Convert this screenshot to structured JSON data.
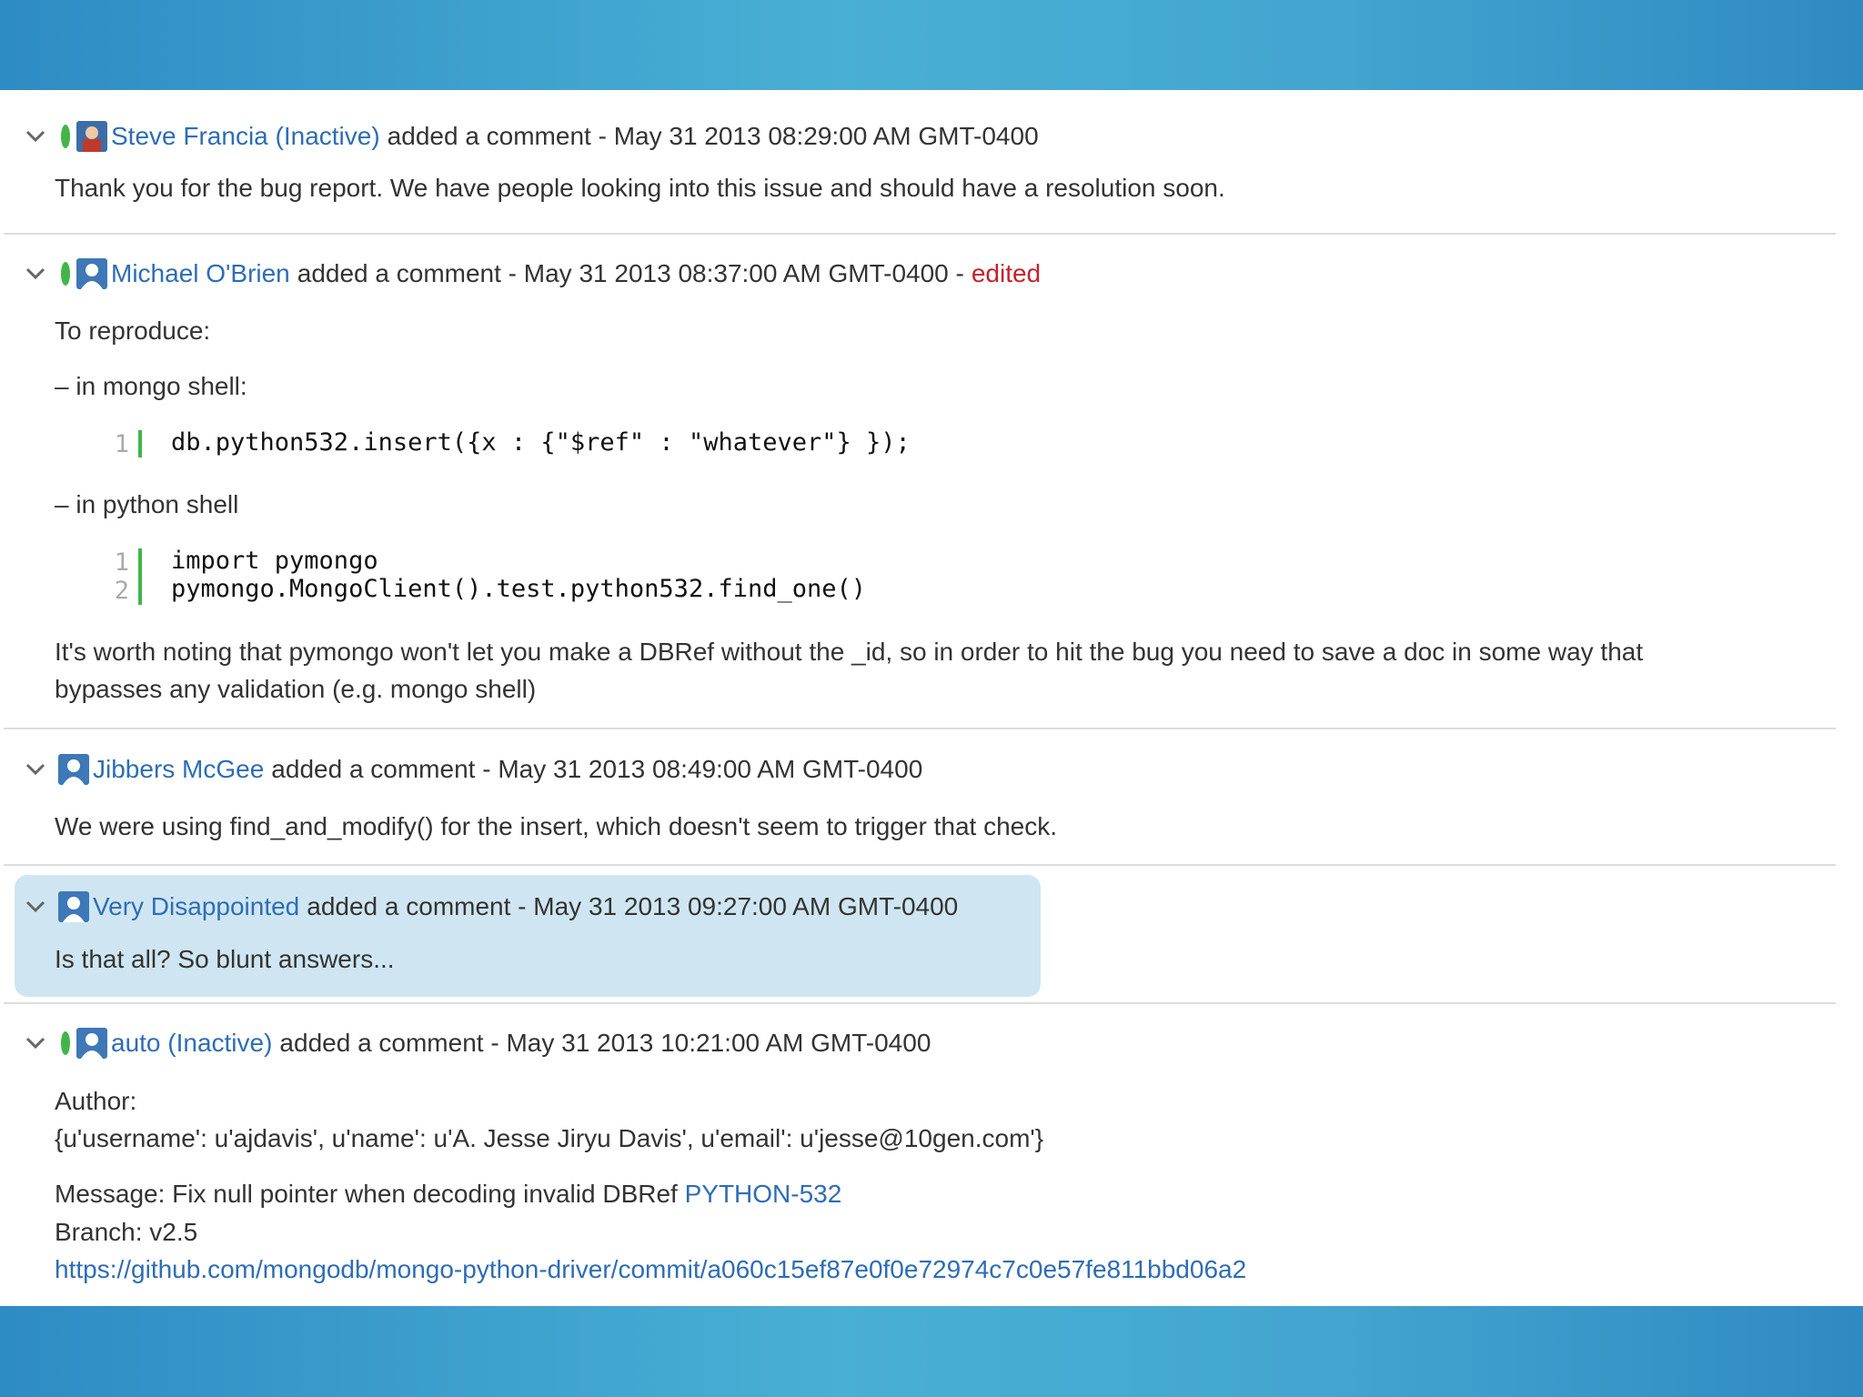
{
  "colors": {
    "accent": "#2e6db4",
    "leaf": "#42b549",
    "edited": "#c3222b",
    "highlight": "#cfe6f2"
  },
  "comments": [
    {
      "author": "Steve Francia (Inactive)",
      "meta": "added a comment - May 31 2013 08:29:00 AM GMT-0400",
      "body": "Thank you for the bug report. We have people looking into this issue and should have a resolution soon."
    },
    {
      "author": "Michael O'Brien",
      "meta": "added a comment - May 31 2013 08:37:00 AM GMT-0400 -",
      "edited": "edited",
      "p1": "To reproduce:",
      "p2": "– in mongo shell:",
      "code1": [
        {
          "n": "1",
          "t": "db.python532.insert({x : {\"$ref\" : \"whatever\"} });"
        }
      ],
      "p3": "– in python shell",
      "code2": [
        {
          "n": "1",
          "t": "import pymongo"
        },
        {
          "n": "2",
          "t": "pymongo.MongoClient().test.python532.find_one()"
        }
      ],
      "p4a": "It's worth noting that pymongo won't let you make a DBRef without the _id, so in order to hit the bug you need to save a doc in some way that",
      "p4b": "bypasses any validation (e.g. mongo shell)"
    },
    {
      "author": "Jibbers McGee",
      "meta": "added a comment - May 31 2013 08:49:00 AM GMT-0400",
      "body": "We were using find_and_modify() for the insert, which doesn't seem to trigger that check."
    },
    {
      "author": "Very Disappointed",
      "meta": "added a comment - May 31 2013 09:27:00 AM GMT-0400",
      "body": "Is that all? So blunt answers..."
    },
    {
      "author": "auto (Inactive)",
      "meta": "added a comment - May 31 2013 10:21:00 AM GMT-0400",
      "l1": "Author:",
      "l2": "{u'username': u'ajdavis', u'name': u'A. Jesse Jiryu Davis', u'email': u'jesse@10gen.com'}",
      "l3": "Message: Fix null pointer when decoding invalid DBRef",
      "l3link": "PYTHON-532",
      "l4": "Branch: v2.5",
      "l5": "https://github.com/mongodb/mongo-python-driver/commit/a060c15ef87e0f0e72974c7c0e57fe811bbd06a2"
    }
  ]
}
